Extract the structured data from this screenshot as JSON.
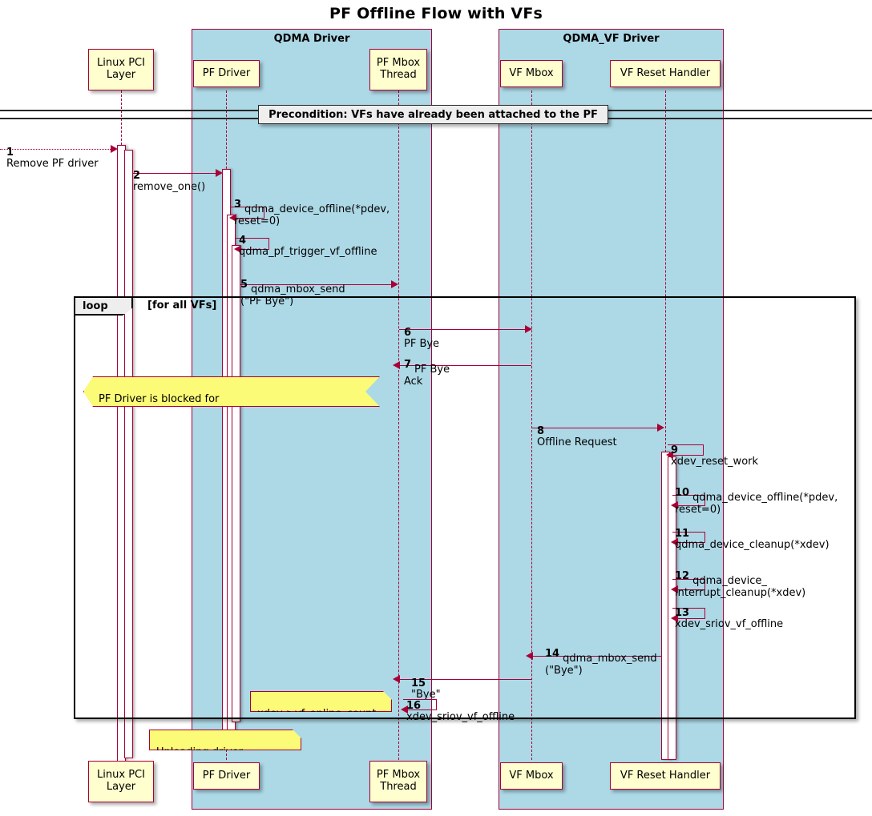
{
  "diagram": {
    "title": "PF Offline Flow with VFs",
    "type": "uml-sequence-diagram"
  },
  "groups": [
    {
      "label": "QDMA Driver"
    },
    {
      "label": "QDMA_VF Driver"
    }
  ],
  "participants": [
    {
      "name": "Linux PCI\nLayer"
    },
    {
      "name": "PF Driver"
    },
    {
      "name": "PF Mbox\nThread"
    },
    {
      "name": "VF Mbox"
    },
    {
      "name": "VF Reset Handler"
    }
  ],
  "divider": {
    "text": "Precondition: VFs have already been attached to the PF"
  },
  "loop": {
    "keyword": "loop",
    "guard": "[for all VFs]"
  },
  "messages": [
    {
      "seq": "1",
      "text": "Remove PF driver"
    },
    {
      "seq": "2",
      "text": "remove_one()"
    },
    {
      "seq": "3",
      "text": "qdma_device_offline(*pdev,\nreset=0)"
    },
    {
      "seq": "4",
      "text": "qdma_pf_trigger_vf_offline"
    },
    {
      "seq": "5",
      "text": "qdma_mbox_send\n(\"PF Bye\")"
    },
    {
      "seq": "6",
      "text": "PF Bye"
    },
    {
      "seq": "7",
      "text": "PF Bye\nAck"
    },
    {
      "seq": "8",
      "text": "Offline Request"
    },
    {
      "seq": "9",
      "text": "xdev_reset_work"
    },
    {
      "seq": "10",
      "text": "qdma_device_offline(*pdev,\nreset=0)"
    },
    {
      "seq": "11",
      "text": "qdma_device_cleanup(*xdev)"
    },
    {
      "seq": "12",
      "text": "qdma_device_\ninterrupt_cleanup(*xdev)"
    },
    {
      "seq": "13",
      "text": "xdev_sriov_vf_offline"
    },
    {
      "seq": "14",
      "text": "qdma_mbox_send\n(\"Bye\")"
    },
    {
      "seq": "15",
      "text": "\"Bye\""
    },
    {
      "seq": "16",
      "text": "xdev_sriov_vf_offline"
    }
  ],
  "notes": [
    {
      "id": "blocked",
      "text": "PF Driver is blocked for\nByes from all VFs which have QDMA_VF driver loaded"
    },
    {
      "id": "count",
      "text": "xdev->vf_online_count--"
    },
    {
      "id": "unload",
      "text": "Unloading driver complete"
    }
  ],
  "colors": {
    "accent": "#A80036",
    "group_fill": "#ADD8E6",
    "actor_fill": "#FEFECE",
    "note_fill": "#FBFB77",
    "divider_fill": "#EEEEEE",
    "background": "#FFFFFF"
  }
}
